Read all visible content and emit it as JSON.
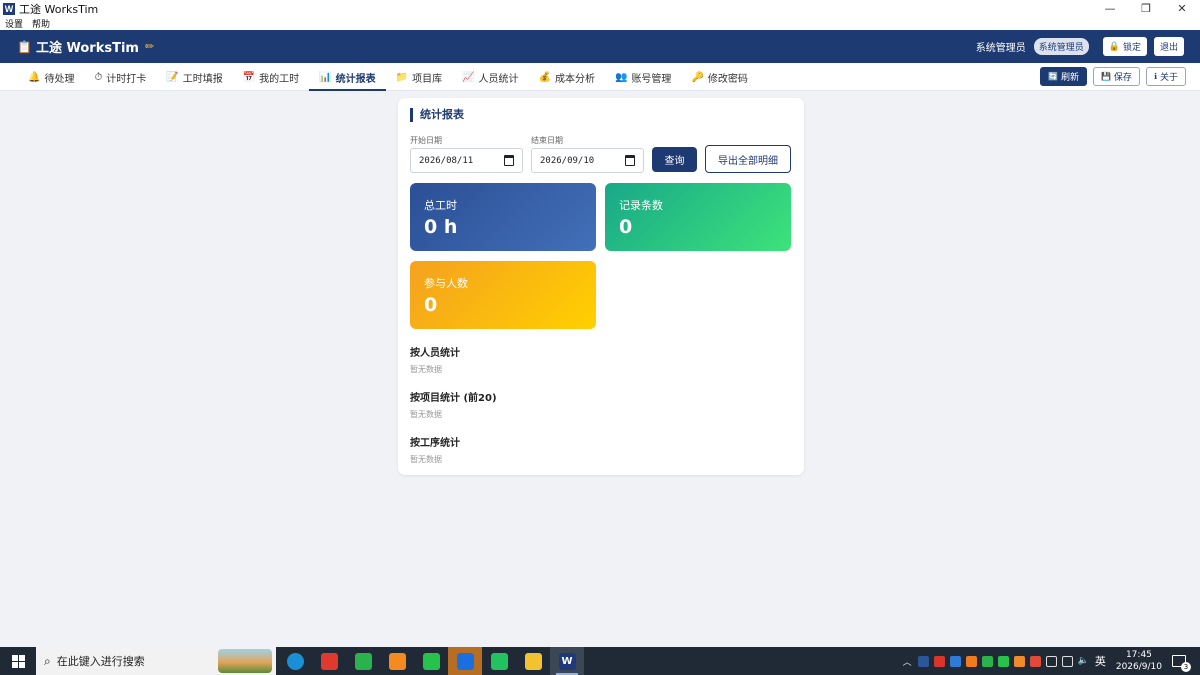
{
  "window": {
    "icon_letter": "W",
    "title": "工途 WorksTim",
    "controls": [
      "—",
      "❐",
      "✕"
    ]
  },
  "menu": [
    "设置",
    "帮助"
  ],
  "header": {
    "brand": "工途 WorksTim",
    "user": "系统管理员",
    "role": "系统管理员",
    "lock_label": "锁定",
    "logout_label": "退出"
  },
  "tabs": [
    {
      "icon": "🔔",
      "label": "待处理"
    },
    {
      "icon": "⏱",
      "label": "计时打卡"
    },
    {
      "icon": "📝",
      "label": "工时填报"
    },
    {
      "icon": "📅",
      "label": "我的工时"
    },
    {
      "icon": "📊",
      "label": "统计报表",
      "active": true
    },
    {
      "icon": "📁",
      "label": "项目库"
    },
    {
      "icon": "📈",
      "label": "人员统计"
    },
    {
      "icon": "💰",
      "label": "成本分析"
    },
    {
      "icon": "👥",
      "label": "账号管理"
    },
    {
      "icon": "🔑",
      "label": "修改密码"
    }
  ],
  "toolbar": {
    "refresh_label": "刷新",
    "save_label": "保存",
    "about_label": "关于"
  },
  "report": {
    "title": "统计报表",
    "start_label": "开始日期",
    "start_value": "2026/08/11",
    "end_label": "结束日期",
    "end_value": "2026/09/10",
    "query_label": "查询",
    "export_label": "导出全部明细",
    "stats": [
      {
        "label": "总工时",
        "value": "0 h"
      },
      {
        "label": "记录条数",
        "value": "0"
      },
      {
        "label": "参与人数",
        "value": "0"
      }
    ],
    "sections": [
      {
        "title": "按人员统计",
        "empty": "暂无数据"
      },
      {
        "title": "按项目统计 (前20)",
        "empty": "暂无数据"
      },
      {
        "title": "按工序统计",
        "empty": "暂无数据"
      }
    ]
  },
  "taskbar": {
    "search_placeholder": "在此键入进行搜索",
    "ime": "英",
    "time": "17:45",
    "date": "2026/9/10",
    "notifications": "3",
    "colors": {
      "bg": "#1f2a36",
      "accent": "#1e3a72"
    }
  }
}
